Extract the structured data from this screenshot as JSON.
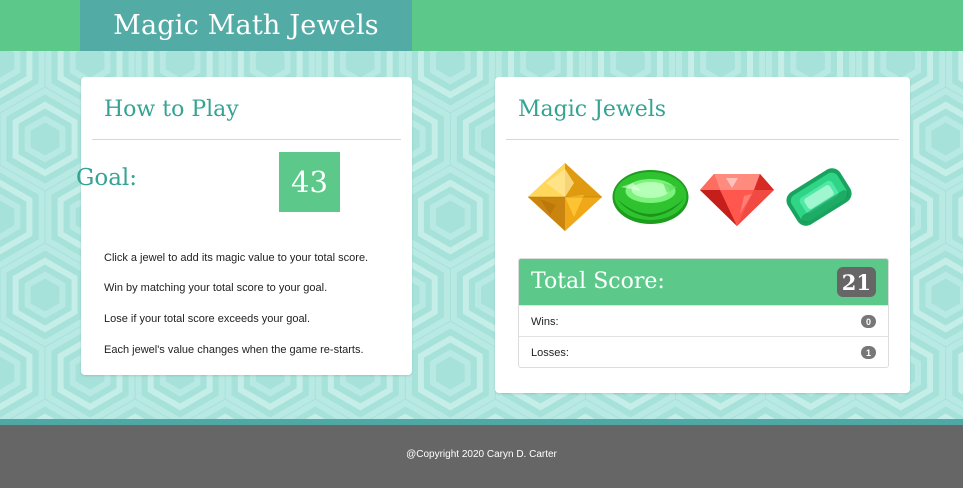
{
  "header": {
    "title": "Magic Math Jewels"
  },
  "how_to_play": {
    "title": "How to Play",
    "goal_label": "Goal:",
    "goal_value": "43",
    "rules": [
      "Click a jewel to add its magic value to your total score.",
      "Win by matching your total score to your goal.",
      "Lose if your total score exceeds your goal.",
      "Each jewel's value changes when the game re-starts."
    ]
  },
  "magic_jewels": {
    "title": "Magic Jewels",
    "jewels": [
      {
        "name": "yellow-jewel",
        "color": "#f2b21e"
      },
      {
        "name": "green-round-jewel",
        "color": "#2fbf2f"
      },
      {
        "name": "red-jewel",
        "color": "#ea3a32"
      },
      {
        "name": "emerald-jewel",
        "color": "#29c27a"
      }
    ]
  },
  "score": {
    "label": "Total Score:",
    "value": "21",
    "wins_label": "Wins:",
    "wins": "0",
    "losses_label": "Losses:",
    "losses": "1"
  },
  "footer": {
    "copyright": "@Copyright 2020 Caryn D. Carter"
  },
  "colors": {
    "header_green": "#5cc98a",
    "brand_teal": "#53aba6",
    "title_teal": "#35a393",
    "background_aqua": "#a6e1da",
    "footer_gray": "#666666"
  }
}
